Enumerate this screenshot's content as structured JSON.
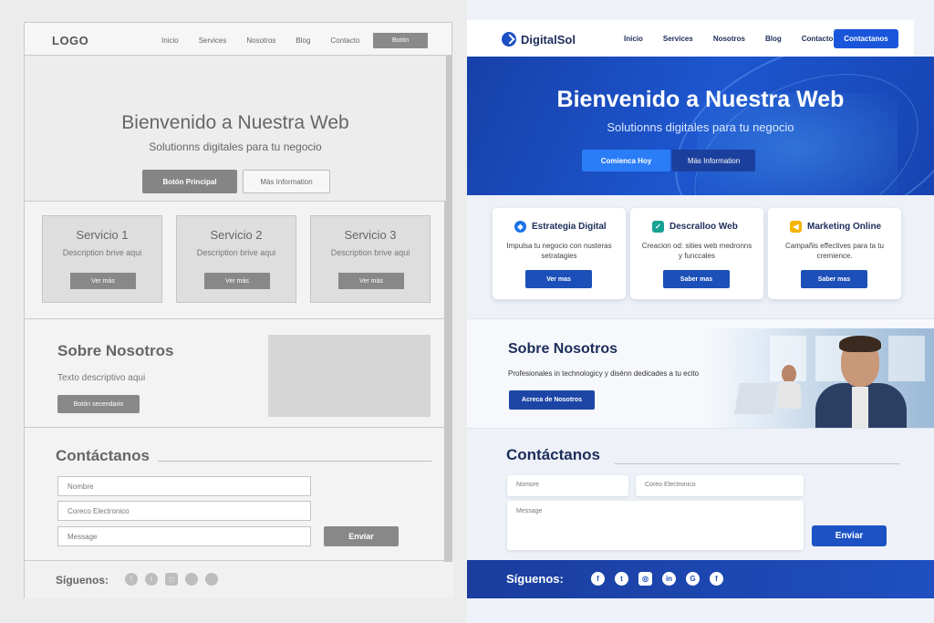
{
  "wireframe": {
    "logo": "LOGO",
    "nav": [
      "Inicio",
      "Services",
      "Nosotros",
      "Blog",
      "Contacto"
    ],
    "nav_button": "Botón",
    "hero": {
      "title": "Bienvenido a Nuestra Web",
      "subtitle": "Solutionns digitales para tu negocio",
      "primary_button": "Botón Principal",
      "secondary_button": "Más Information"
    },
    "services": [
      {
        "title": "Servicio 1",
        "desc": "Description brive aqui",
        "button": "Ver más"
      },
      {
        "title": "Servicio 2",
        "desc": "Description brive aqui",
        "button": "Ver más"
      },
      {
        "title": "Servicio 3",
        "desc": "Description brive aqui",
        "button": "Ver más"
      }
    ],
    "about": {
      "title": "Sobre Nosotros",
      "text": "Texto descriptivo aqui",
      "button": "Botón secendario"
    },
    "contact": {
      "title": "Contáctanos",
      "name_placeholder": "Nombre",
      "email_placeholder": "Coreco Electronico",
      "message_placeholder": "Message",
      "send_button": "Enviar"
    },
    "footer": {
      "follow_label": "Síguenos:"
    }
  },
  "mockup": {
    "logo": "DigitalSol",
    "nav": [
      "Inicio",
      "Services",
      "Nosotros",
      "Blog",
      "Contacto"
    ],
    "nav_button": "Contactanos",
    "hero": {
      "title": "Bienvenido a Nuestra Web",
      "subtitle": "Solutionns digitales para tu negocio",
      "primary_button": "Comienca Hoy",
      "secondary_button": "Más Information"
    },
    "services": [
      {
        "title": "Estrategia Digital",
        "desc": "Impulsa tu negocio con nusteras setratagies",
        "button": "Ver mas",
        "icon": "shield-icon",
        "color": "#1a73e8"
      },
      {
        "title": "Descralloo Web",
        "desc": "Creacion od: sities web medronns y funccales",
        "button": "Saber mas",
        "icon": "check-icon",
        "color": "#16a394"
      },
      {
        "title": "Marketing Online",
        "desc": "Campañis effectives para ta tu cremience.",
        "button": "Saber mas",
        "icon": "megaphone-icon",
        "color": "#f5b400"
      }
    ],
    "about": {
      "title": "Sobre Nosotros",
      "text": "Profesionales in technologicy y disénn dedicades a tu ecito",
      "button": "Acreca de Nosotros"
    },
    "contact": {
      "title": "Contáctanos",
      "name_placeholder": "Nomore",
      "email_placeholder": "Coreo Electronico",
      "message_placeholder": "Message",
      "send_button": "Enviar"
    },
    "footer": {
      "follow_label": "Síguenos:",
      "social_icons": [
        "facebook-icon",
        "twitter-icon",
        "instagram-icon",
        "linkedin-icon",
        "google-icon",
        "facebook-icon"
      ]
    },
    "colors": {
      "brand": "#1a56db",
      "hero": "#1d56cf",
      "navy": "#1b2d5a"
    }
  }
}
